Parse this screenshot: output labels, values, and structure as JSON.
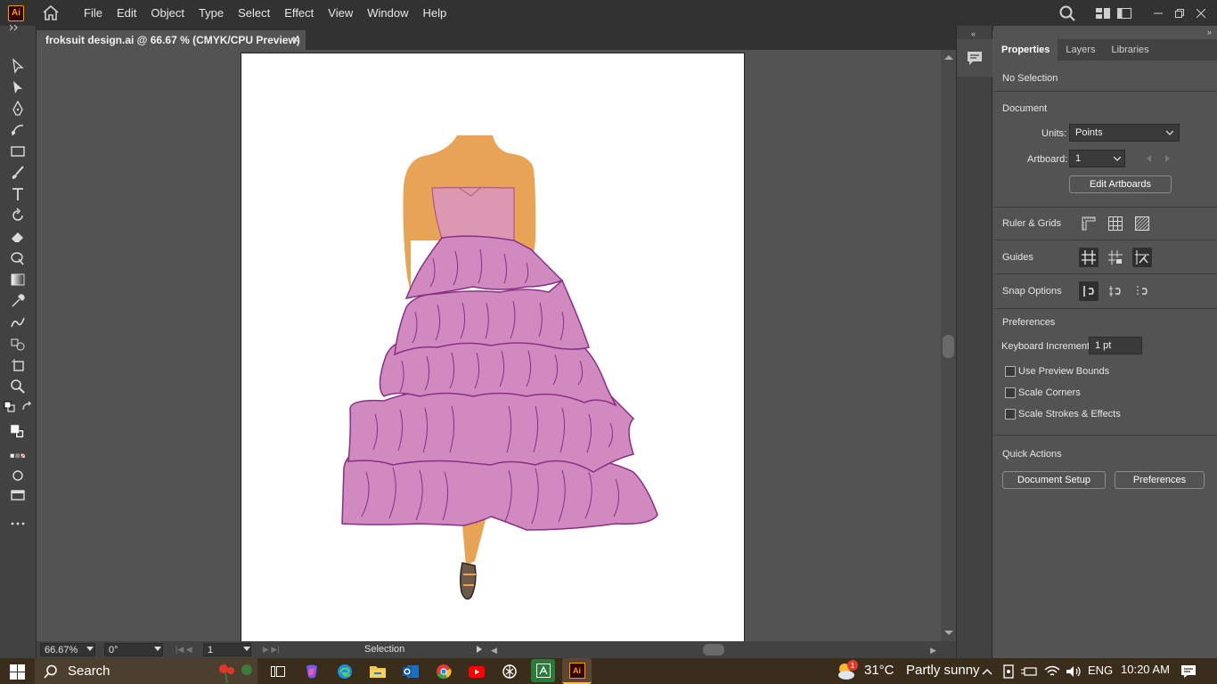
{
  "menubar": {
    "app_logo": "Ai",
    "items": [
      "File",
      "Edit",
      "Object",
      "Type",
      "Select",
      "Effect",
      "View",
      "Window",
      "Help"
    ]
  },
  "document": {
    "tab_title": "froksuit design.ai @ 66.67 % (CMYK/CPU Preview)",
    "close": "×"
  },
  "statusbar": {
    "zoom": "66.67%",
    "rotation": "0°",
    "artboard": "1",
    "tool": "Selection"
  },
  "properties": {
    "tabs": [
      "Properties",
      "Layers",
      "Libraries"
    ],
    "selection": "No Selection",
    "document_heading": "Document",
    "units_label": "Units:",
    "units_value": "Points",
    "artboard_label": "Artboard:",
    "artboard_value": "1",
    "edit_artboards": "Edit Artboards",
    "ruler_grids": "Ruler & Grids",
    "guides": "Guides",
    "snap_options": "Snap Options",
    "preferences_heading": "Preferences",
    "keyboard_increment_label": "Keyboard Increment:",
    "keyboard_increment_value": "1 pt",
    "use_preview_bounds": "Use Preview Bounds",
    "scale_corners": "Scale Corners",
    "scale_strokes": "Scale Strokes & Effects",
    "quick_actions": "Quick Actions",
    "document_setup": "Document Setup",
    "preferences_button": "Preferences"
  },
  "taskbar": {
    "search_placeholder": "Search",
    "weather_badge": "1",
    "temperature": "31°C",
    "weather": "Partly sunny",
    "language": "ENG",
    "time": "10:20 AM"
  },
  "colors": {
    "dress": "#d08ac0",
    "dress_stroke": "#8a2e86",
    "skin": "#e8a456",
    "bodice": "#dc98b0"
  }
}
